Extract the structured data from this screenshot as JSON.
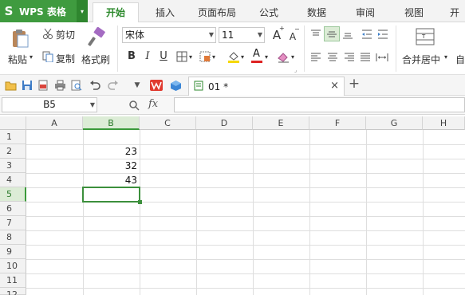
{
  "app": {
    "logo_glyph": "S",
    "name": "WPS 表格",
    "dropdown_glyph": "▾"
  },
  "tabs": [
    {
      "label": "开始",
      "active": true
    },
    {
      "label": "插入",
      "active": false
    },
    {
      "label": "页面布局",
      "active": false
    },
    {
      "label": "公式",
      "active": false
    },
    {
      "label": "数据",
      "active": false
    },
    {
      "label": "审阅",
      "active": false
    },
    {
      "label": "视图",
      "active": false
    },
    {
      "label": "开",
      "active": false
    }
  ],
  "ribbon": {
    "paste_label": "粘贴",
    "cut_label": "剪切",
    "copy_label": "复制",
    "format_painter_label": "格式刷",
    "font_name": "宋体",
    "font_size": "11",
    "bold": "B",
    "italic": "I",
    "underline": "U",
    "merge_label": "合并居中",
    "next_label": "自",
    "grow_font": "A",
    "shrink_font": "A",
    "font_color_letter": "A"
  },
  "quickbar": {
    "doc_tab_label": "01 *",
    "close_glyph": "×",
    "new_tab_glyph": "+"
  },
  "formula_bar": {
    "name_box": "B5",
    "fx_label": "fx",
    "formula_value": ""
  },
  "columns": [
    "A",
    "B",
    "C",
    "D",
    "E",
    "F",
    "G",
    "H"
  ],
  "rows": [
    "1",
    "2",
    "3",
    "4",
    "5",
    "6",
    "7",
    "8",
    "9",
    "10",
    "11",
    "12"
  ],
  "selected": {
    "column": "B",
    "row": "5"
  },
  "cells": {
    "B2": "23",
    "B3": "32",
    "B4": "43"
  },
  "colors": {
    "brand_green": "#3f9b3f",
    "active_tab_text": "#2d8a2d",
    "selection_green": "#3c8f3c",
    "header_highlight": "#dcecd6"
  }
}
